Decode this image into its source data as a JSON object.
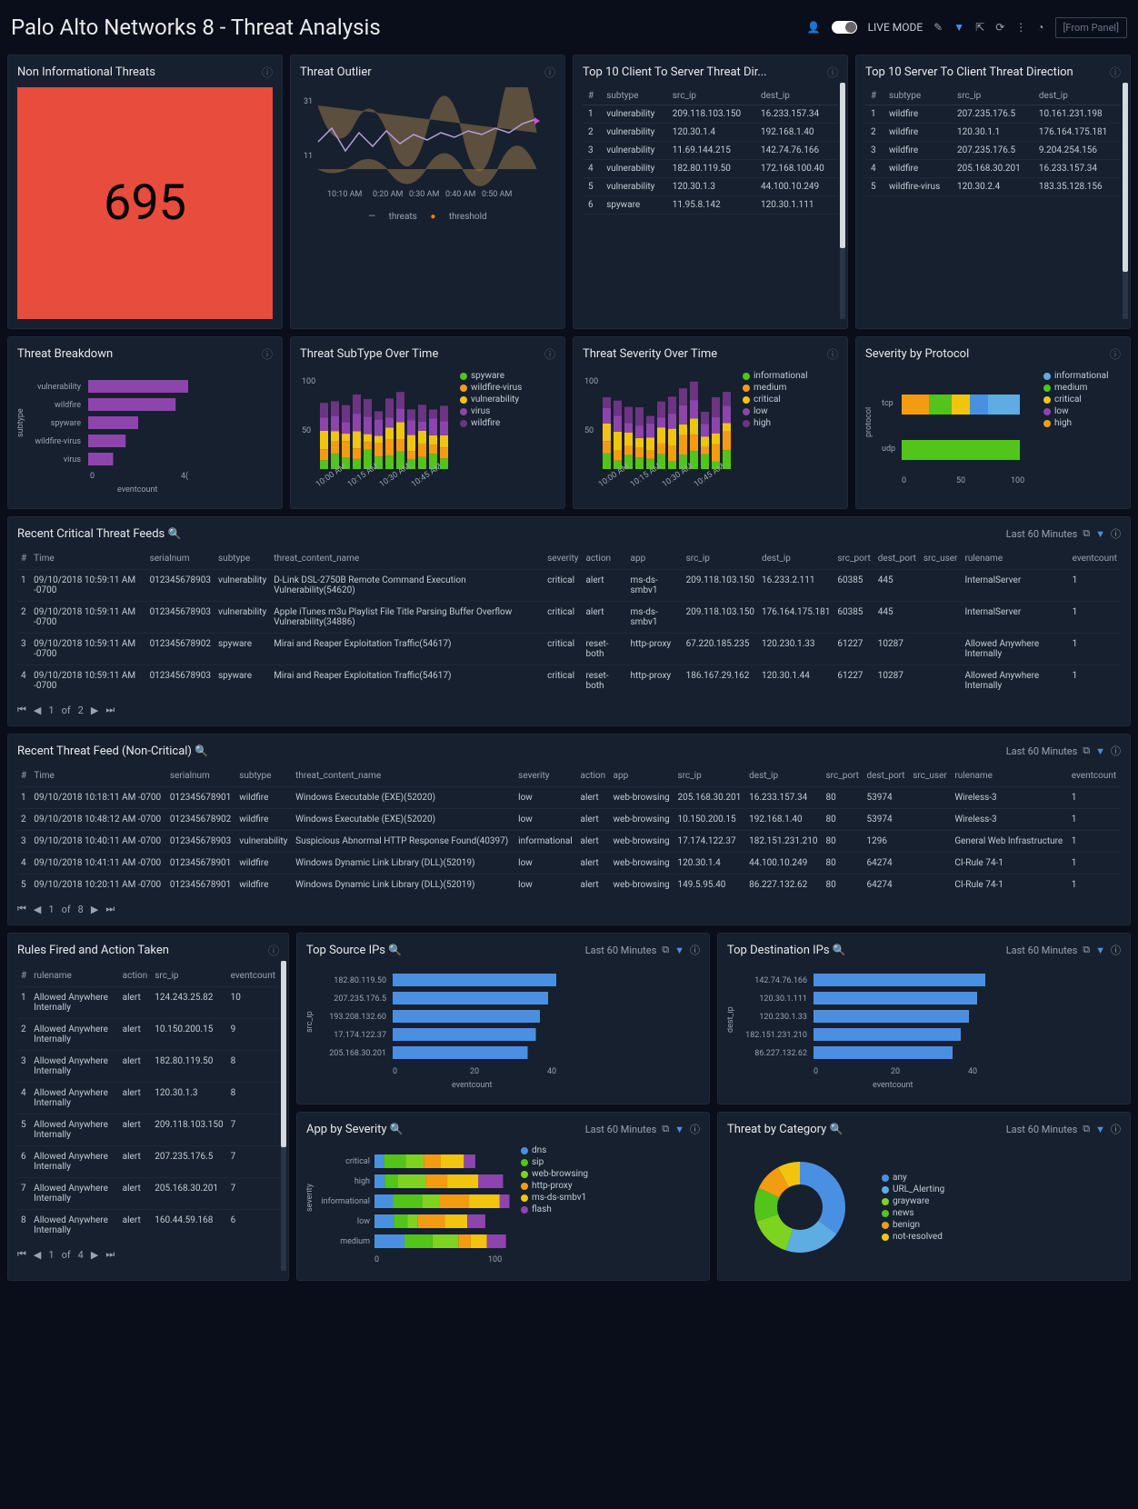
{
  "header": {
    "title": "Palo Alto Networks 8 - Threat Analysis",
    "live_mode_label": "LIVE MODE",
    "from_panel_label": "[From Panel]"
  },
  "panels": {
    "non_informational": {
      "title": "Non Informational Threats",
      "value": "695"
    },
    "outlier": {
      "title": "Threat Outlier",
      "y_ticks": [
        "31",
        "11"
      ],
      "x_ticks": [
        "10:10 AM",
        "0:20 AM",
        "0:30 AM",
        "0:40 AM",
        "0:50 AM"
      ],
      "legend": {
        "threats": "threats",
        "threshold": "threshold"
      }
    },
    "top10_c2s": {
      "title": "Top 10 Client To Server Threat Dir...",
      "columns": [
        "#",
        "subtype",
        "src_ip",
        "dest_ip"
      ],
      "rows": [
        [
          "1",
          "vulnerability",
          "209.118.103.150",
          "16.233.157.34"
        ],
        [
          "2",
          "vulnerability",
          "120.30.1.4",
          "192.168.1.40"
        ],
        [
          "3",
          "vulnerability",
          "11.69.144.215",
          "142.74.76.166"
        ],
        [
          "4",
          "vulnerability",
          "182.80.119.50",
          "172.168.100.40"
        ],
        [
          "5",
          "vulnerability",
          "120.30.1.3",
          "44.100.10.249"
        ],
        [
          "6",
          "spyware",
          "11.95.8.142",
          "120.30.1.111"
        ]
      ]
    },
    "top10_s2c": {
      "title": "Top 10 Server To Client Threat Direction",
      "columns": [
        "#",
        "subtype",
        "src_ip",
        "dest_ip"
      ],
      "rows": [
        [
          "1",
          "wildfire",
          "207.235.176.5",
          "10.161.231.198"
        ],
        [
          "2",
          "wildfire",
          "120.30.1.1",
          "176.164.175.181"
        ],
        [
          "3",
          "wildfire",
          "207.235.176.5",
          "9.204.254.156"
        ],
        [
          "4",
          "wildfire",
          "205.168.30.201",
          "16.233.157.34"
        ],
        [
          "5",
          "wildfire-virus",
          "120.30.2.4",
          "183.35.128.156"
        ]
      ]
    },
    "breakdown": {
      "title": "Threat Breakdown",
      "ylabel": "subtype",
      "xlabel": "eventcount",
      "x_ticks": [
        "0",
        "4("
      ]
    },
    "subtype_time": {
      "title": "Threat SubType Over Time",
      "y_ticks": [
        "100",
        "50"
      ],
      "x_ticks": [
        "10:00 AM",
        "10:15 AM",
        "10:30 AM",
        "10:45 AM"
      ],
      "legend": [
        "spyware",
        "wildfire-virus",
        "vulnerability",
        "virus",
        "wildfire"
      ]
    },
    "severity_time": {
      "title": "Threat Severity Over Time",
      "y_ticks": [
        "100",
        "50"
      ],
      "x_ticks": [
        "10:00 AM",
        "10:15 AM",
        "10:30 AM",
        "10:45 AM"
      ],
      "legend": [
        "informational",
        "medium",
        "critical",
        "low",
        "high"
      ]
    },
    "severity_protocol": {
      "title": "Severity by Protocol",
      "ylabel": "protocol",
      "y_cats": [
        "tcp",
        "udp"
      ],
      "x_ticks": [
        "0",
        "50",
        "100"
      ],
      "legend": [
        "informational",
        "medium",
        "critical",
        "low",
        "high"
      ]
    },
    "recent_critical": {
      "title": "Recent Critical Threat Feeds",
      "range": "Last 60 Minutes",
      "columns": [
        "#",
        "Time",
        "serialnum",
        "subtype",
        "threat_content_name",
        "severity",
        "action",
        "app",
        "src_ip",
        "dest_ip",
        "src_port",
        "dest_port",
        "src_user",
        "rulename",
        "eventcount"
      ],
      "rows": [
        [
          "1",
          "09/10/2018 10:59:11 AM -0700",
          "012345678903",
          "vulnerability",
          "D-Link DSL-2750B Remote Command Execution Vulnerability(54620)",
          "critical",
          "alert",
          "ms-ds-smbv1",
          "209.118.103.150",
          "16.233.2.111",
          "60385",
          "445",
          "",
          "InternalServer",
          "1"
        ],
        [
          "2",
          "09/10/2018 10:59:11 AM -0700",
          "012345678903",
          "vulnerability",
          "Apple iTunes m3u Playlist File Title Parsing Buffer Overflow Vulnerability(34886)",
          "critical",
          "alert",
          "ms-ds-smbv1",
          "209.118.103.150",
          "176.164.175.181",
          "60385",
          "445",
          "",
          "InternalServer",
          "1"
        ],
        [
          "3",
          "09/10/2018 10:59:11 AM -0700",
          "012345678902",
          "spyware",
          "Mirai and Reaper Exploitation Traffic(54617)",
          "critical",
          "reset-both",
          "http-proxy",
          "67.220.185.235",
          "120.230.1.33",
          "61227",
          "10287",
          "",
          "Allowed Anywhere Internally",
          "1"
        ],
        [
          "4",
          "09/10/2018 10:59:11 AM -0700",
          "012345678903",
          "spyware",
          "Mirai and Reaper Exploitation Traffic(54617)",
          "critical",
          "reset-both",
          "http-proxy",
          "186.167.29.162",
          "120.30.1.44",
          "61227",
          "10287",
          "",
          "Allowed Anywhere Internally",
          "1"
        ]
      ],
      "page_current": "1",
      "page_of": "of",
      "page_total": "2"
    },
    "recent_noncritical": {
      "title": "Recent Threat Feed (Non-Critical)",
      "range": "Last 60 Minutes",
      "columns": [
        "#",
        "Time",
        "serialnum",
        "subtype",
        "threat_content_name",
        "severity",
        "action",
        "app",
        "src_ip",
        "dest_ip",
        "src_port",
        "dest_port",
        "src_user",
        "rulename",
        "eventcount"
      ],
      "rows": [
        [
          "1",
          "09/10/2018 10:18:11 AM -0700",
          "012345678901",
          "wildfire",
          "Windows Executable (EXE)(52020)",
          "low",
          "alert",
          "web-browsing",
          "205.168.30.201",
          "16.233.157.34",
          "80",
          "53974",
          "",
          "Wireless-3",
          "1"
        ],
        [
          "2",
          "09/10/2018 10:48:12 AM -0700",
          "012345678902",
          "wildfire",
          "Windows Executable (EXE)(52020)",
          "low",
          "alert",
          "web-browsing",
          "10.150.200.15",
          "192.168.1.40",
          "80",
          "53974",
          "",
          "Wireless-3",
          "1"
        ],
        [
          "3",
          "09/10/2018 10:40:11 AM -0700",
          "012345678903",
          "vulnerability",
          "Suspicious Abnormal HTTP Response Found(40397)",
          "informational",
          "alert",
          "web-browsing",
          "17.174.122.37",
          "182.151.231.210",
          "80",
          "1296",
          "",
          "General Web Infrastructure",
          "1"
        ],
        [
          "4",
          "09/10/2018 10:41:11 AM -0700",
          "012345678901",
          "wildfire",
          "Windows Dynamic Link Library (DLL)(52019)",
          "low",
          "alert",
          "web-browsing",
          "120.30.1.4",
          "44.100.10.249",
          "80",
          "64274",
          "",
          "CI-Rule 74-1",
          "1"
        ],
        [
          "5",
          "09/10/2018 10:20:11 AM -0700",
          "012345678901",
          "wildfire",
          "Windows Dynamic Link Library (DLL)(52019)",
          "low",
          "alert",
          "web-browsing",
          "149.5.95.40",
          "86.227.132.62",
          "80",
          "64274",
          "",
          "CI-Rule 74-1",
          "1"
        ]
      ],
      "page_current": "1",
      "page_of": "of",
      "page_total": "8"
    },
    "rules_fired": {
      "title": "Rules Fired and Action Taken",
      "columns": [
        "#",
        "rulename",
        "action",
        "src_ip",
        "eventcount"
      ],
      "rows": [
        [
          "1",
          "Allowed Anywhere Internally",
          "alert",
          "124.243.25.82",
          "10"
        ],
        [
          "2",
          "Allowed Anywhere Internally",
          "alert",
          "10.150.200.15",
          "9"
        ],
        [
          "3",
          "Allowed Anywhere Internally",
          "alert",
          "182.80.119.50",
          "8"
        ],
        [
          "4",
          "Allowed Anywhere Internally",
          "alert",
          "120.30.1.3",
          "8"
        ],
        [
          "5",
          "Allowed Anywhere Internally",
          "alert",
          "209.118.103.150",
          "7"
        ],
        [
          "6",
          "Allowed Anywhere Internally",
          "alert",
          "207.235.176.5",
          "7"
        ],
        [
          "7",
          "Allowed Anywhere Internally",
          "alert",
          "205.168.30.201",
          "7"
        ],
        [
          "8",
          "Allowed Anywhere Internally",
          "alert",
          "160.44.59.168",
          "6"
        ]
      ],
      "page_current": "1",
      "page_of": "of",
      "page_total": "4"
    },
    "top_source_ips": {
      "title": "Top Source IPs",
      "range": "Last 60 Minutes",
      "ylabel": "src_ip",
      "xlabel": "eventcount",
      "x_ticks": [
        "0",
        "20",
        "40"
      ]
    },
    "top_dest_ips": {
      "title": "Top Destination IPs",
      "range": "Last 60 Minutes",
      "ylabel": "dest_ip",
      "xlabel": "eventcount",
      "x_ticks": [
        "0",
        "20",
        "40"
      ]
    },
    "app_by_severity": {
      "title": "App by Severity",
      "range": "Last 60 Minutes",
      "ylabel": "severity",
      "x_ticks": [
        "0",
        "100"
      ],
      "legend": [
        "dns",
        "sip",
        "web-browsing",
        "http-proxy",
        "ms-ds-smbv1",
        "flash"
      ]
    },
    "threat_by_category": {
      "title": "Threat by Category",
      "range": "Last 60 Minutes",
      "legend": [
        "any",
        "URL_Alerting",
        "grayware",
        "news",
        "benign",
        "not-resolved"
      ]
    }
  },
  "chart_data": {
    "threat_breakdown": {
      "type": "bar",
      "orientation": "horizontal",
      "categories": [
        "vulnerability",
        "wildfire",
        "spyware",
        "wildfire-virus",
        "virus"
      ],
      "values": [
        40,
        35,
        20,
        15,
        10
      ],
      "xlabel": "eventcount",
      "ylabel": "subtype",
      "xlim": [
        0,
        40
      ],
      "colors": [
        "#8e44ad",
        "#8e44ad",
        "#8e44ad",
        "#8e44ad",
        "#8e44ad"
      ]
    },
    "threat_outlier": {
      "type": "line",
      "x": [
        "10:10 AM",
        "10:20 AM",
        "10:30 AM",
        "10:40 AM",
        "10:50 AM"
      ],
      "series": [
        {
          "name": "threats",
          "color": "#b39ddb"
        },
        {
          "name": "threshold",
          "color": "#e67e22"
        }
      ],
      "ylim": [
        11,
        31
      ]
    },
    "subtype_over_time": {
      "type": "bar",
      "stacked": true,
      "x": [
        "10:00 AM",
        "10:15 AM",
        "10:30 AM",
        "10:45 AM"
      ],
      "series_names": [
        "spyware",
        "wildfire-virus",
        "vulnerability",
        "virus",
        "wildfire"
      ],
      "colors": [
        "#52c41a",
        "#f39c12",
        "#f1c40f",
        "#8e44ad",
        "#6c3483"
      ],
      "ylim": [
        0,
        100
      ]
    },
    "severity_over_time": {
      "type": "bar",
      "stacked": true,
      "x": [
        "10:00 AM",
        "10:15 AM",
        "10:30 AM",
        "10:45 AM"
      ],
      "series_names": [
        "informational",
        "medium",
        "critical",
        "low",
        "high"
      ],
      "colors": [
        "#52c41a",
        "#f39c12",
        "#f1c40f",
        "#8e44ad",
        "#6c3483"
      ],
      "ylim": [
        0,
        100
      ]
    },
    "severity_by_protocol": {
      "type": "bar",
      "orientation": "horizontal",
      "stacked": true,
      "categories": [
        "tcp",
        "udp"
      ],
      "series": [
        {
          "name": "informational",
          "values": [
            20,
            0
          ],
          "color": "#5dade2"
        },
        {
          "name": "medium",
          "values": [
            25,
            100
          ],
          "color": "#52c41a"
        },
        {
          "name": "critical",
          "values": [
            10,
            0
          ],
          "color": "#f1c40f"
        },
        {
          "name": "low",
          "values": [
            15,
            0
          ],
          "color": "#8e44ad"
        },
        {
          "name": "high",
          "values": [
            30,
            0
          ],
          "color": "#f39c12"
        }
      ],
      "xlim": [
        0,
        100
      ]
    },
    "top_source_ips": {
      "type": "bar",
      "orientation": "horizontal",
      "categories": [
        "182.80.119.50",
        "207.235.176.5",
        "193.208.132.60",
        "17.174.122.37",
        "205.168.30.201"
      ],
      "values": [
        40,
        38,
        36,
        35,
        33
      ],
      "xlabel": "eventcount",
      "ylabel": "src_ip",
      "xlim": [
        0,
        40
      ],
      "color": "#4a90e2"
    },
    "top_dest_ips": {
      "type": "bar",
      "orientation": "horizontal",
      "categories": [
        "142.74.76.166",
        "120.30.1.111",
        "120.230.1.33",
        "182.151.231.210",
        "86.227.132.62"
      ],
      "values": [
        42,
        40,
        38,
        36,
        34
      ],
      "xlabel": "eventcount",
      "ylabel": "dest_ip",
      "xlim": [
        0,
        40
      ],
      "color": "#4a90e2"
    },
    "app_by_severity": {
      "type": "bar",
      "orientation": "horizontal",
      "stacked": true,
      "categories": [
        "critical",
        "high",
        "informational",
        "low",
        "medium"
      ],
      "series_names": [
        "dns",
        "sip",
        "web-browsing",
        "http-proxy",
        "ms-ds-smbv1",
        "flash"
      ],
      "colors": [
        "#4a90e2",
        "#52c41a",
        "#7ed321",
        "#f39c12",
        "#f1c40f",
        "#8e44ad"
      ],
      "xlim": [
        0,
        100
      ]
    },
    "threat_by_category": {
      "type": "pie",
      "donut": true,
      "labels": [
        "any",
        "URL_Alerting",
        "grayware",
        "news",
        "benign",
        "not-resolved"
      ],
      "values": [
        35,
        20,
        15,
        12,
        10,
        8
      ],
      "colors": [
        "#4a90e2",
        "#5dade2",
        "#7ed321",
        "#52c41a",
        "#f39c12",
        "#f1c40f"
      ]
    }
  },
  "colors": {
    "spyware": "#52c41a",
    "wildfire_virus": "#f39c12",
    "vulnerability": "#f1c40f",
    "virus": "#8e44ad",
    "wildfire": "#6c3483",
    "informational": "#52c41a",
    "medium": "#f39c12",
    "critical": "#f1c40f",
    "low": "#8e44ad",
    "high": "#6c3483",
    "blue": "#4a90e2"
  }
}
